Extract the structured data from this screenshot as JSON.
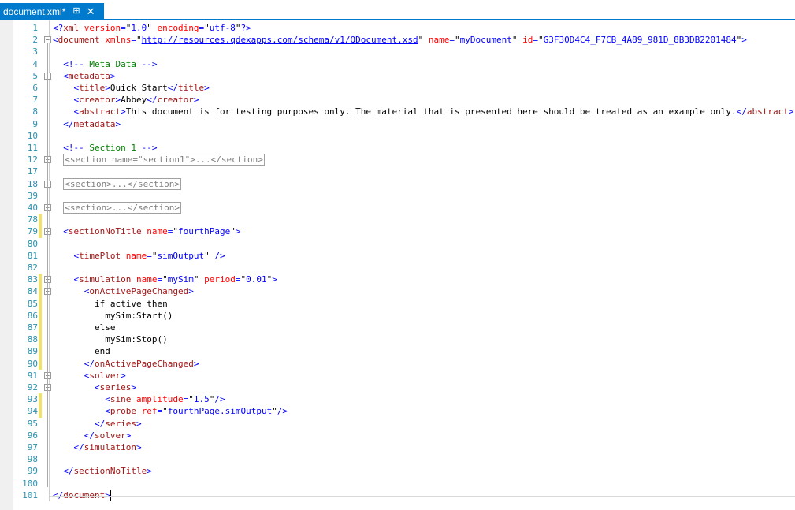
{
  "tab": {
    "title": "document.xml*",
    "pin_icon": "⊞",
    "close_icon": "✕"
  },
  "lines": [
    {
      "n": "1",
      "y": 0,
      "indent": "",
      "tokens": [
        [
          "d",
          "<?"
        ],
        [
          "t",
          "xml"
        ],
        [
          "a",
          " version"
        ],
        [
          "d",
          "="
        ],
        [
          "x",
          "\""
        ],
        [
          "v",
          "1.0"
        ],
        [
          "x",
          "\""
        ],
        [
          "a",
          " encoding"
        ],
        [
          "d",
          "="
        ],
        [
          "x",
          "\""
        ],
        [
          "v",
          "utf-8"
        ],
        [
          "x",
          "\""
        ],
        [
          "d",
          "?>"
        ]
      ]
    },
    {
      "n": "2",
      "y": 1,
      "fold": "-",
      "tokens": [
        [
          "d",
          "<"
        ],
        [
          "t",
          "document"
        ],
        [
          "a",
          " xmlns"
        ],
        [
          "d",
          "="
        ],
        [
          "x",
          "\""
        ],
        [
          "u",
          "http://resources.qdexapps.com/schema/v1/QDocument.xsd"
        ],
        [
          "x",
          "\""
        ],
        [
          "a",
          " name"
        ],
        [
          "d",
          "="
        ],
        [
          "x",
          "\""
        ],
        [
          "v",
          "myDocument"
        ],
        [
          "x",
          "\""
        ],
        [
          "a",
          " id"
        ],
        [
          "d",
          "="
        ],
        [
          "x",
          "\""
        ],
        [
          "v",
          "G3F30D4C4_F7CB_4A89_981D_8B3DB2201484"
        ],
        [
          "x",
          "\""
        ],
        [
          "d",
          ">"
        ]
      ]
    },
    {
      "n": "3",
      "y": 2,
      "tokens": []
    },
    {
      "n": "4",
      "y": 3,
      "tokens": [
        [
          "x",
          "  "
        ],
        [
          "d",
          "<!--"
        ],
        [
          "c",
          " Meta Data "
        ],
        [
          "d",
          "-->"
        ]
      ]
    },
    {
      "n": "5",
      "y": 4,
      "fold": "-",
      "tokens": [
        [
          "x",
          "  "
        ],
        [
          "d",
          "<"
        ],
        [
          "t",
          "metadata"
        ],
        [
          "d",
          ">"
        ]
      ]
    },
    {
      "n": "6",
      "y": 5,
      "tokens": [
        [
          "x",
          "    "
        ],
        [
          "d",
          "<"
        ],
        [
          "t",
          "title"
        ],
        [
          "d",
          ">"
        ],
        [
          "x",
          "Quick Start"
        ],
        [
          "d",
          "</"
        ],
        [
          "t",
          "title"
        ],
        [
          "d",
          ">"
        ]
      ]
    },
    {
      "n": "7",
      "y": 6,
      "tokens": [
        [
          "x",
          "    "
        ],
        [
          "d",
          "<"
        ],
        [
          "t",
          "creator"
        ],
        [
          "d",
          ">"
        ],
        [
          "x",
          "Abbey"
        ],
        [
          "d",
          "</"
        ],
        [
          "t",
          "creator"
        ],
        [
          "d",
          ">"
        ]
      ]
    },
    {
      "n": "8",
      "y": 7,
      "tokens": [
        [
          "x",
          "    "
        ],
        [
          "d",
          "<"
        ],
        [
          "t",
          "abstract"
        ],
        [
          "d",
          ">"
        ],
        [
          "x",
          "This document is for testing purposes only. The material that is presented here should be treated as an example only."
        ],
        [
          "d",
          "</"
        ],
        [
          "t",
          "abstract"
        ],
        [
          "d",
          ">"
        ]
      ]
    },
    {
      "n": "9",
      "y": 8,
      "tokens": [
        [
          "x",
          "  "
        ],
        [
          "d",
          "</"
        ],
        [
          "t",
          "metadata"
        ],
        [
          "d",
          ">"
        ]
      ]
    },
    {
      "n": "10",
      "y": 9,
      "tokens": []
    },
    {
      "n": "11",
      "y": 10,
      "tokens": [
        [
          "x",
          "  "
        ],
        [
          "d",
          "<!--"
        ],
        [
          "c",
          " Section 1 "
        ],
        [
          "d",
          "-->"
        ]
      ]
    },
    {
      "n": "12",
      "y": 11,
      "fold": "+",
      "tokens": [
        [
          "x",
          "  "
        ],
        [
          "box",
          "<section name=\"section1\">...</section>"
        ]
      ]
    },
    {
      "n": "17",
      "y": 12,
      "tokens": []
    },
    {
      "n": "18",
      "y": 13,
      "fold": "+",
      "tokens": [
        [
          "x",
          "  "
        ],
        [
          "box",
          "<section>...</section>"
        ]
      ]
    },
    {
      "n": "39",
      "y": 14,
      "tokens": []
    },
    {
      "n": "40",
      "y": 15,
      "fold": "+",
      "tokens": [
        [
          "x",
          "  "
        ],
        [
          "box",
          "<section>...</section>"
        ]
      ]
    },
    {
      "n": "78",
      "y": 16,
      "chg": true,
      "tokens": []
    },
    {
      "n": "79",
      "y": 17,
      "chg": true,
      "fold": "-",
      "tokens": [
        [
          "x",
          "  "
        ],
        [
          "d",
          "<"
        ],
        [
          "t",
          "sectionNoTitle"
        ],
        [
          "a",
          " name"
        ],
        [
          "d",
          "="
        ],
        [
          "x",
          "\""
        ],
        [
          "v",
          "fourthPage"
        ],
        [
          "x",
          "\""
        ],
        [
          "d",
          ">"
        ]
      ]
    },
    {
      "n": "80",
      "y": 18,
      "tokens": []
    },
    {
      "n": "81",
      "y": 19,
      "tokens": [
        [
          "x",
          "    "
        ],
        [
          "d",
          "<"
        ],
        [
          "t",
          "timePlot"
        ],
        [
          "a",
          " name"
        ],
        [
          "d",
          "="
        ],
        [
          "x",
          "\""
        ],
        [
          "v",
          "simOutput"
        ],
        [
          "x",
          "\""
        ],
        [
          "d",
          " />"
        ]
      ]
    },
    {
      "n": "82",
      "y": 20,
      "tokens": []
    },
    {
      "n": "83",
      "y": 21,
      "chg": true,
      "fold": "-",
      "tokens": [
        [
          "x",
          "    "
        ],
        [
          "d",
          "<"
        ],
        [
          "t",
          "simulation"
        ],
        [
          "a",
          " name"
        ],
        [
          "d",
          "="
        ],
        [
          "x",
          "\""
        ],
        [
          "v",
          "mySim"
        ],
        [
          "x",
          "\""
        ],
        [
          "a",
          " period"
        ],
        [
          "d",
          "="
        ],
        [
          "x",
          "\""
        ],
        [
          "v",
          "0.01"
        ],
        [
          "x",
          "\""
        ],
        [
          "d",
          ">"
        ]
      ]
    },
    {
      "n": "84",
      "y": 22,
      "chg": true,
      "fold": "-",
      "tokens": [
        [
          "x",
          "      "
        ],
        [
          "d",
          "<"
        ],
        [
          "t",
          "onActivePageChanged"
        ],
        [
          "d",
          ">"
        ]
      ]
    },
    {
      "n": "85",
      "y": 23,
      "chg": true,
      "tokens": [
        [
          "x",
          "        if active then"
        ]
      ]
    },
    {
      "n": "86",
      "y": 24,
      "chg": true,
      "tokens": [
        [
          "x",
          "          mySim:Start()"
        ]
      ]
    },
    {
      "n": "87",
      "y": 25,
      "chg": true,
      "tokens": [
        [
          "x",
          "        else"
        ]
      ]
    },
    {
      "n": "88",
      "y": 26,
      "chg": true,
      "tokens": [
        [
          "x",
          "          mySim:Stop()"
        ]
      ]
    },
    {
      "n": "89",
      "y": 27,
      "chg": true,
      "tokens": [
        [
          "x",
          "        end"
        ]
      ]
    },
    {
      "n": "90",
      "y": 28,
      "chg": true,
      "tokens": [
        [
          "x",
          "      "
        ],
        [
          "d",
          "</"
        ],
        [
          "t",
          "onActivePageChanged"
        ],
        [
          "d",
          ">"
        ]
      ]
    },
    {
      "n": "91",
      "y": 29,
      "fold": "-",
      "tokens": [
        [
          "x",
          "      "
        ],
        [
          "d",
          "<"
        ],
        [
          "t",
          "solver"
        ],
        [
          "d",
          ">"
        ]
      ]
    },
    {
      "n": "92",
      "y": 30,
      "fold": "-",
      "tokens": [
        [
          "x",
          "        "
        ],
        [
          "d",
          "<"
        ],
        [
          "t",
          "series"
        ],
        [
          "d",
          ">"
        ]
      ]
    },
    {
      "n": "93",
      "y": 31,
      "chg": true,
      "tokens": [
        [
          "x",
          "          "
        ],
        [
          "d",
          "<"
        ],
        [
          "t",
          "sine"
        ],
        [
          "a",
          " amplitude"
        ],
        [
          "d",
          "="
        ],
        [
          "x",
          "\""
        ],
        [
          "v",
          "1.5"
        ],
        [
          "x",
          "\""
        ],
        [
          "d",
          "/>"
        ]
      ]
    },
    {
      "n": "94",
      "y": 32,
      "chg": true,
      "tokens": [
        [
          "x",
          "          "
        ],
        [
          "d",
          "<"
        ],
        [
          "t",
          "probe"
        ],
        [
          "a",
          " ref"
        ],
        [
          "d",
          "="
        ],
        [
          "x",
          "\""
        ],
        [
          "v",
          "fourthPage.simOutput"
        ],
        [
          "x",
          "\""
        ],
        [
          "d",
          "/>"
        ]
      ]
    },
    {
      "n": "95",
      "y": 33,
      "tokens": [
        [
          "x",
          "        "
        ],
        [
          "d",
          "</"
        ],
        [
          "t",
          "series"
        ],
        [
          "d",
          ">"
        ]
      ]
    },
    {
      "n": "96",
      "y": 34,
      "tokens": [
        [
          "x",
          "      "
        ],
        [
          "d",
          "</"
        ],
        [
          "t",
          "solver"
        ],
        [
          "d",
          ">"
        ]
      ]
    },
    {
      "n": "97",
      "y": 35,
      "tokens": [
        [
          "x",
          "    "
        ],
        [
          "d",
          "</"
        ],
        [
          "t",
          "simulation"
        ],
        [
          "d",
          ">"
        ]
      ]
    },
    {
      "n": "98",
      "y": 36,
      "tokens": []
    },
    {
      "n": "99",
      "y": 37,
      "tokens": [
        [
          "x",
          "  "
        ],
        [
          "d",
          "</"
        ],
        [
          "t",
          "sectionNoTitle"
        ],
        [
          "d",
          ">"
        ]
      ]
    },
    {
      "n": "100",
      "y": 38,
      "tokens": []
    },
    {
      "n": "101",
      "y": 39,
      "tokens": [
        [
          "d",
          "</"
        ],
        [
          "t",
          "document"
        ],
        [
          "d",
          ">"
        ]
      ],
      "caret": true
    }
  ]
}
